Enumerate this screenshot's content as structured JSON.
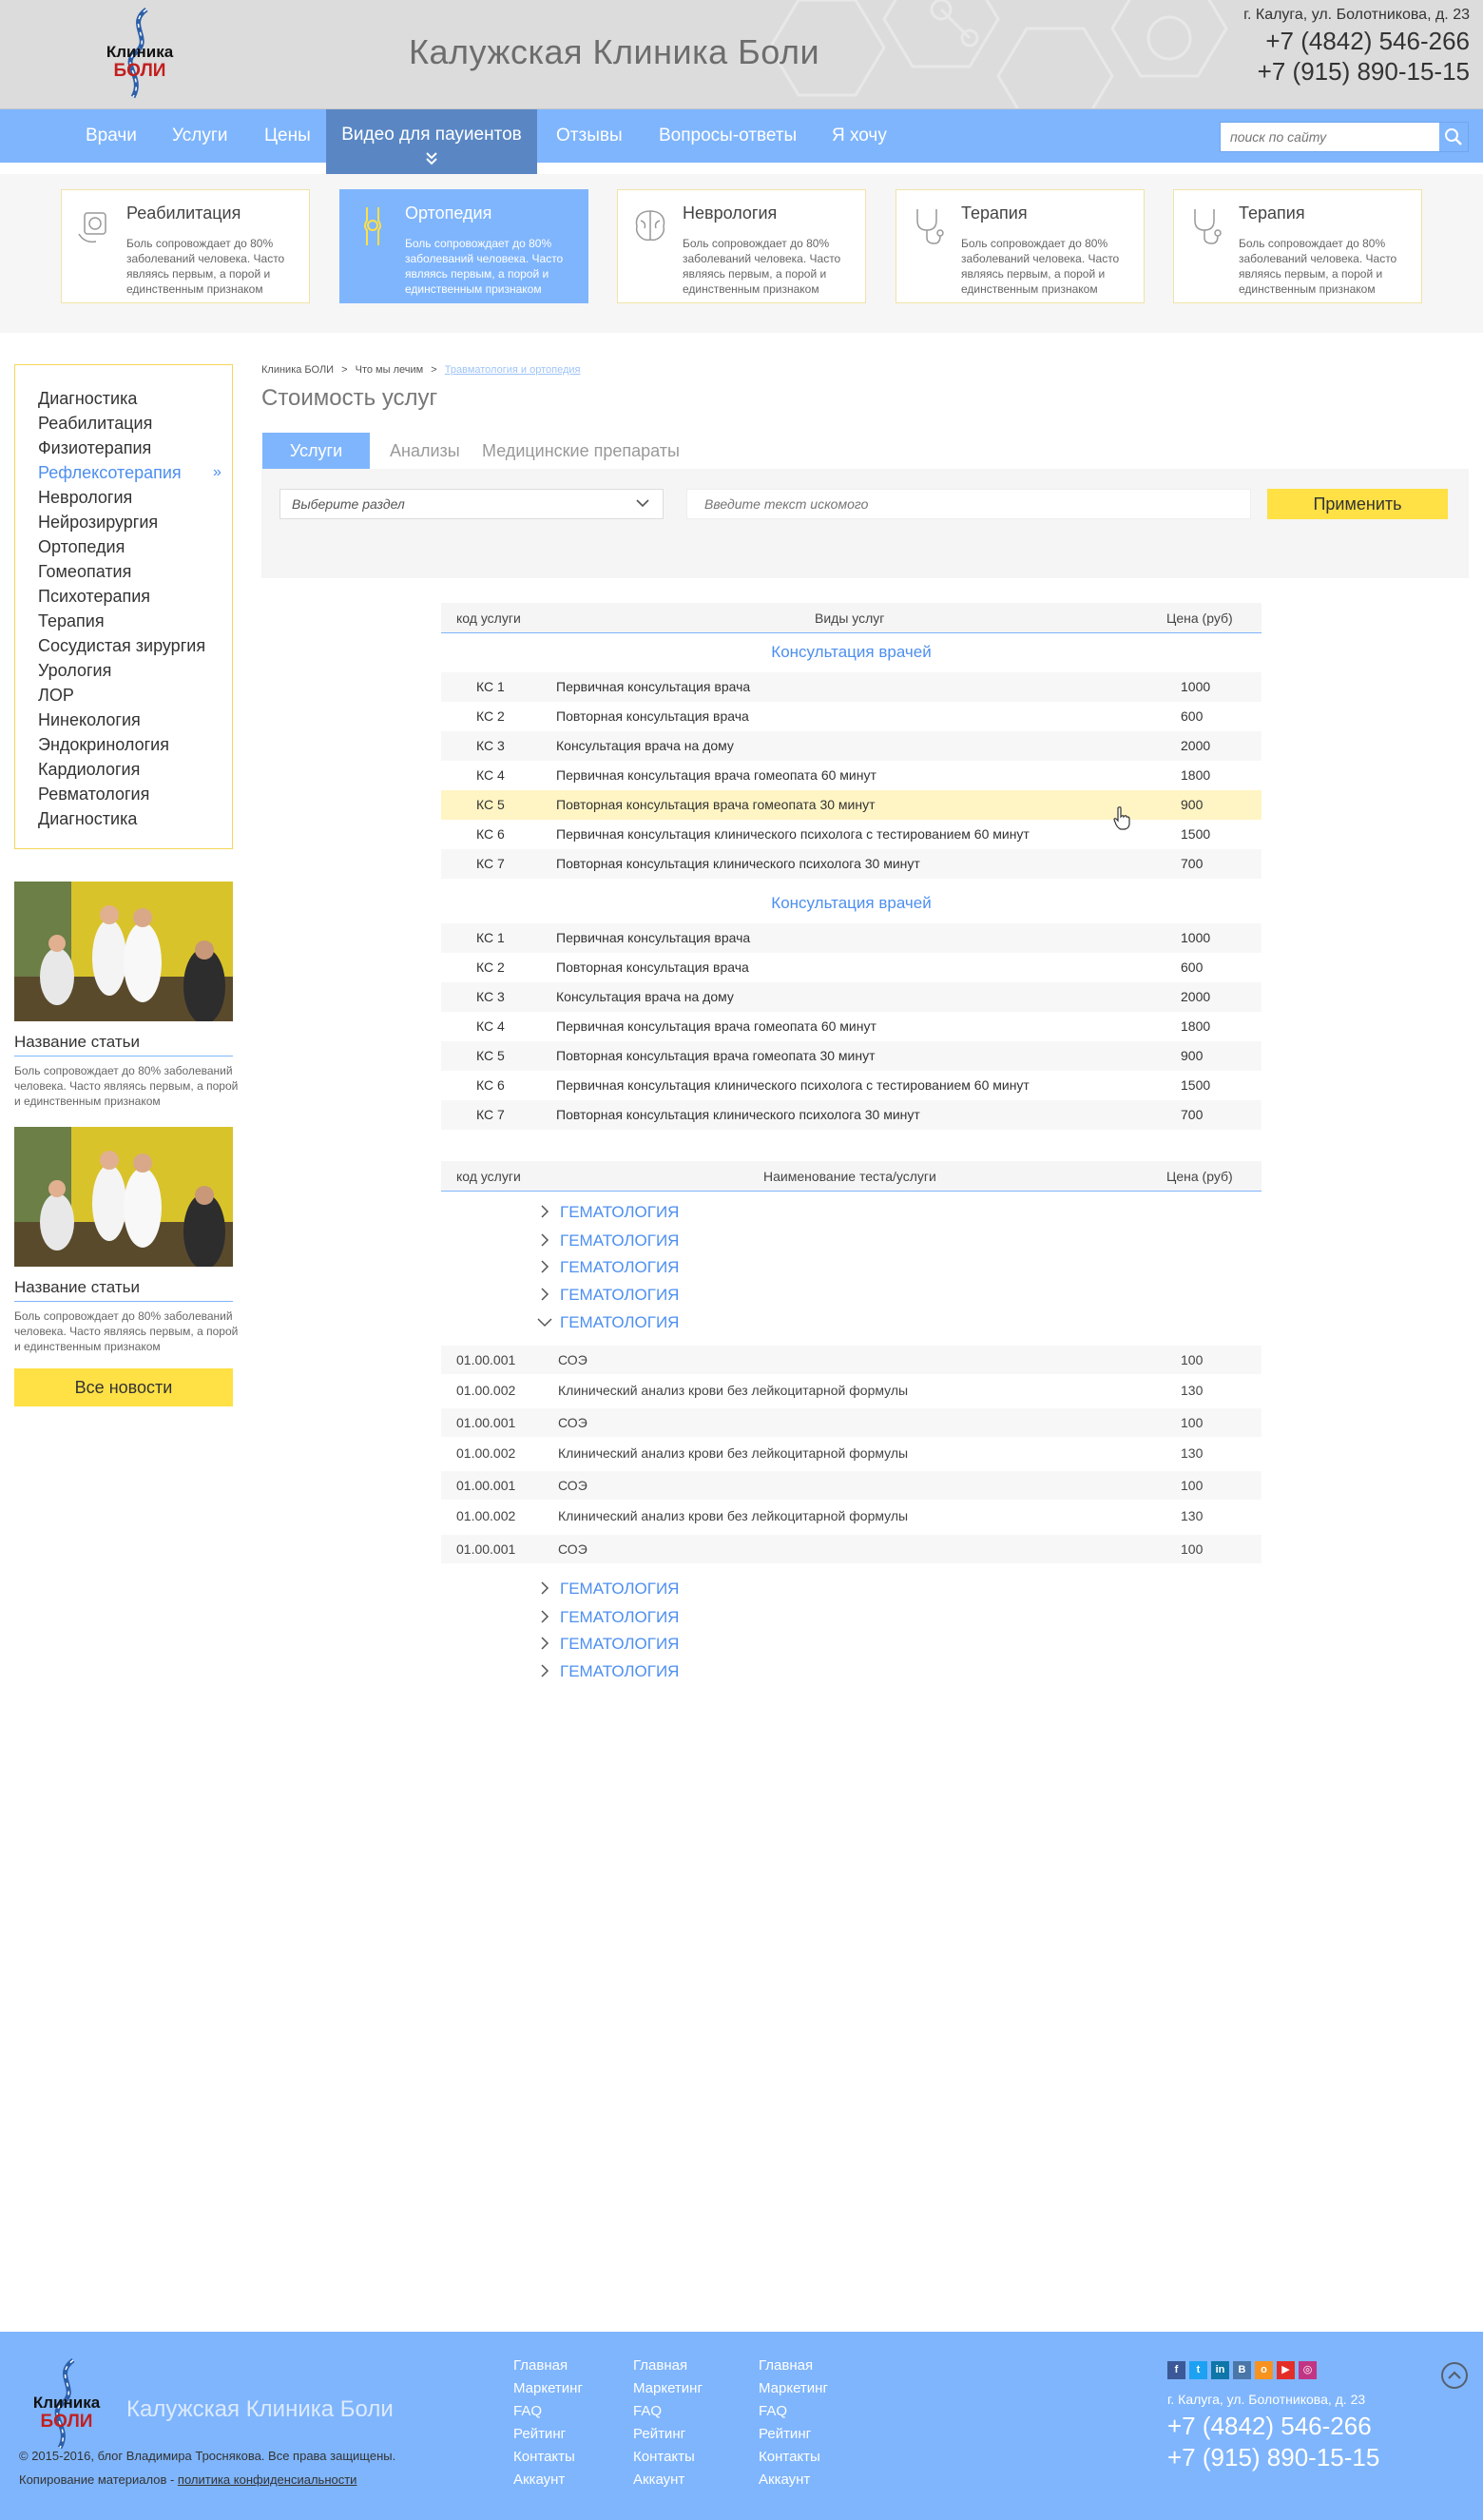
{
  "header": {
    "site_title": "Калужская Клиника Боли",
    "logo_text": "Клиника БОЛИ",
    "address": "г. Калуга, ул. Болотникова, д. 23",
    "phone1": "+7 (4842) 546-266",
    "phone2": "+7 (915) 890-15-15"
  },
  "nav": {
    "items": [
      "Врачи",
      "Услуги",
      "Цены",
      "Видео для пауиентов",
      "Отзывы",
      "Вопросы-ответы",
      "Я хочу"
    ],
    "active_index": 3,
    "search_placeholder": "поиск по сайту"
  },
  "categories": [
    {
      "title": "Реабилитация",
      "desc": "Боль сопровождает до 80% заболеваний человека. Часто являясь первым, а порой и единственным признаком",
      "icon": "rehab-icon",
      "active": false
    },
    {
      "title": "Ортопедия",
      "desc": "Боль сопровождает до 80% заболеваний человека. Часто являясь первым, а порой и единственным признаком",
      "icon": "joint-icon",
      "active": true
    },
    {
      "title": "Неврология",
      "desc": "Боль сопровождает до 80% заболеваний человека. Часто являясь первым, а порой и единственным признаком",
      "icon": "brain-icon",
      "active": false
    },
    {
      "title": "Терапия",
      "desc": "Боль сопровождает до 80% заболеваний человека. Часто являясь первым, а порой и единственным признаком",
      "icon": "stethoscope-icon",
      "active": false
    },
    {
      "title": "Терапия",
      "desc": "Боль сопровождает до 80% заболеваний человека. Часто являясь первым, а порой и единственным признаком",
      "icon": "stethoscope-icon",
      "active": false
    }
  ],
  "sidebar": {
    "items": [
      "Диагностика",
      "Реабилитация",
      "Физиотерапия",
      "Рефлексотерапия",
      "Неврология",
      "Нейрозирургия",
      "Ортопедия",
      "Гомеопатия",
      "Психотерапия",
      "Терапия",
      "Сосудистая зирургия",
      "Урология",
      "ЛОР",
      "Нинекология",
      "Эндокринология",
      "Кардиология",
      "Ревматология",
      "Диагностика"
    ],
    "active_index": 3,
    "articles": [
      {
        "title": "Название статьи",
        "desc": "Боль сопровождает до 80% заболеваний человека. Часто являясь первым, а порой и единственным признаком"
      },
      {
        "title": "Название статьи",
        "desc": "Боль сопровождает до 80% заболеваний человека. Часто являясь первым, а порой и единственным признаком"
      }
    ],
    "all_news": "Все новости"
  },
  "breadcrumb": {
    "items": [
      "Клиника БОЛИ",
      "Что мы лечим",
      "Травматология и ортопедия"
    ],
    "sep": ">"
  },
  "page_title": "Стоимость услуг",
  "tabs": [
    "Услуги",
    "Анализы",
    "Медицинские препараты"
  ],
  "filter": {
    "section_placeholder": "Выберите раздел",
    "search_placeholder": "Введите текст искомого",
    "apply": "Применить"
  },
  "services_table": {
    "headers": [
      "код услуги",
      "Виды услуг",
      "Цена (руб)"
    ],
    "groups": [
      {
        "title": "Консультация врачей",
        "rows": [
          [
            "КС 1",
            "Первичная консультация врача",
            "1000"
          ],
          [
            "КС 2",
            "Повторная консультация врача",
            "600"
          ],
          [
            "КС 3",
            "Консультация врача на дому",
            "2000"
          ],
          [
            "КС 4",
            "Первичная консультация врача гомеопата 60 минут",
            "1800"
          ],
          [
            "КС 5",
            "Повторная консультация врача  гомеопата 30 минут",
            "900"
          ],
          [
            "КС 6",
            "Первичная консультация клинического психолога с тестированием 60 минут",
            "1500"
          ],
          [
            "КС 7",
            "Повторная консультация клинического психолога 30 минут",
            "700"
          ]
        ]
      },
      {
        "title": "Консультация врачей",
        "rows": [
          [
            "КС 1",
            "Первичная консультация врача",
            "1000"
          ],
          [
            "КС 2",
            "Повторная консультация врача",
            "600"
          ],
          [
            "КС 3",
            "Консультация врача на дому",
            "2000"
          ],
          [
            "КС 4",
            "Первичная консультация врача гомеопата 60 минут",
            "1800"
          ],
          [
            "КС 5",
            "Повторная консультация врача  гомеопата 30 минут",
            "900"
          ],
          [
            "КС 6",
            "Первичная консультация клинического психолога с тестированием 60 минут",
            "1500"
          ],
          [
            "КС 7",
            "Повторная консультация клинического психолога 30 минут",
            "700"
          ]
        ]
      }
    ]
  },
  "analyses_table": {
    "headers": [
      "код услуги",
      "Наименование теста/услуги",
      "Цена (руб)"
    ],
    "collapsed_before": [
      "ГЕМАТОЛОГИЯ",
      "ГЕМАТОЛОГИЯ",
      "ГЕМАТОЛОГИЯ",
      "ГЕМАТОЛОГИЯ"
    ],
    "expanded": "ГЕМАТОЛОГИЯ",
    "rows": [
      [
        "01.00.001",
        "СОЭ",
        "100"
      ],
      [
        "01.00.002",
        "Клинический анализ крови без лейкоцитарной формулы",
        "130"
      ],
      [
        "01.00.001",
        "СОЭ",
        "100"
      ],
      [
        "01.00.002",
        "Клинический анализ крови без лейкоцитарной формулы",
        "130"
      ],
      [
        "01.00.001",
        "СОЭ",
        "100"
      ],
      [
        "01.00.002",
        "Клинический анализ крови без лейкоцитарной формулы",
        "130"
      ],
      [
        "01.00.001",
        "СОЭ",
        "100"
      ]
    ],
    "collapsed_after": [
      "ГЕМАТОЛОГИЯ",
      "ГЕМАТОЛОГИЯ",
      "ГЕМАТОЛОГИЯ",
      "ГЕМАТОЛОГИЯ"
    ]
  },
  "footer": {
    "title": "Калужская Клиника Боли",
    "copyright": "© 2015-2016, блог Владимира Троснякова. Все права защищены.",
    "policy_prefix": "Копирование материалов - ",
    "policy_link": "политика конфиденсиальности",
    "columns": [
      [
        "Главная",
        "Маркетинг",
        "FAQ",
        "Рейтинг",
        "Контакты",
        "Аккаунт"
      ],
      [
        "Главная",
        "Маркетинг",
        "FAQ",
        "Рейтинг",
        "Контакты",
        "Аккаунт"
      ],
      [
        "Главная",
        "Маркетинг",
        "FAQ",
        "Рейтинг",
        "Контакты",
        "Аккаунт"
      ]
    ],
    "social": [
      {
        "icon": "facebook-icon",
        "glyph": "f",
        "color": "#3b5998"
      },
      {
        "icon": "twitter-icon",
        "glyph": "t",
        "color": "#1da1f2"
      },
      {
        "icon": "linkedin-icon",
        "glyph": "in",
        "color": "#0e76a8"
      },
      {
        "icon": "vk-icon",
        "glyph": "B",
        "color": "#4a76a8"
      },
      {
        "icon": "odnoklassniki-icon",
        "glyph": "o",
        "color": "#f7931e"
      },
      {
        "icon": "youtube-icon",
        "glyph": "▶",
        "color": "#e52d27"
      },
      {
        "icon": "instagram-icon",
        "glyph": "◎",
        "color": "#c13584"
      }
    ],
    "address": "г. Калуга, ул. Болотникова, д. 23",
    "phone1": "+7 (4842) 546-266",
    "phone2": "+7 (915) 890-15-15"
  },
  "colors": {
    "accent": "#7fb5fc",
    "accent_dark": "#5a87c4",
    "link": "#4d8ff0",
    "yellow": "#ffe045",
    "highlight": "#fff5c4"
  }
}
